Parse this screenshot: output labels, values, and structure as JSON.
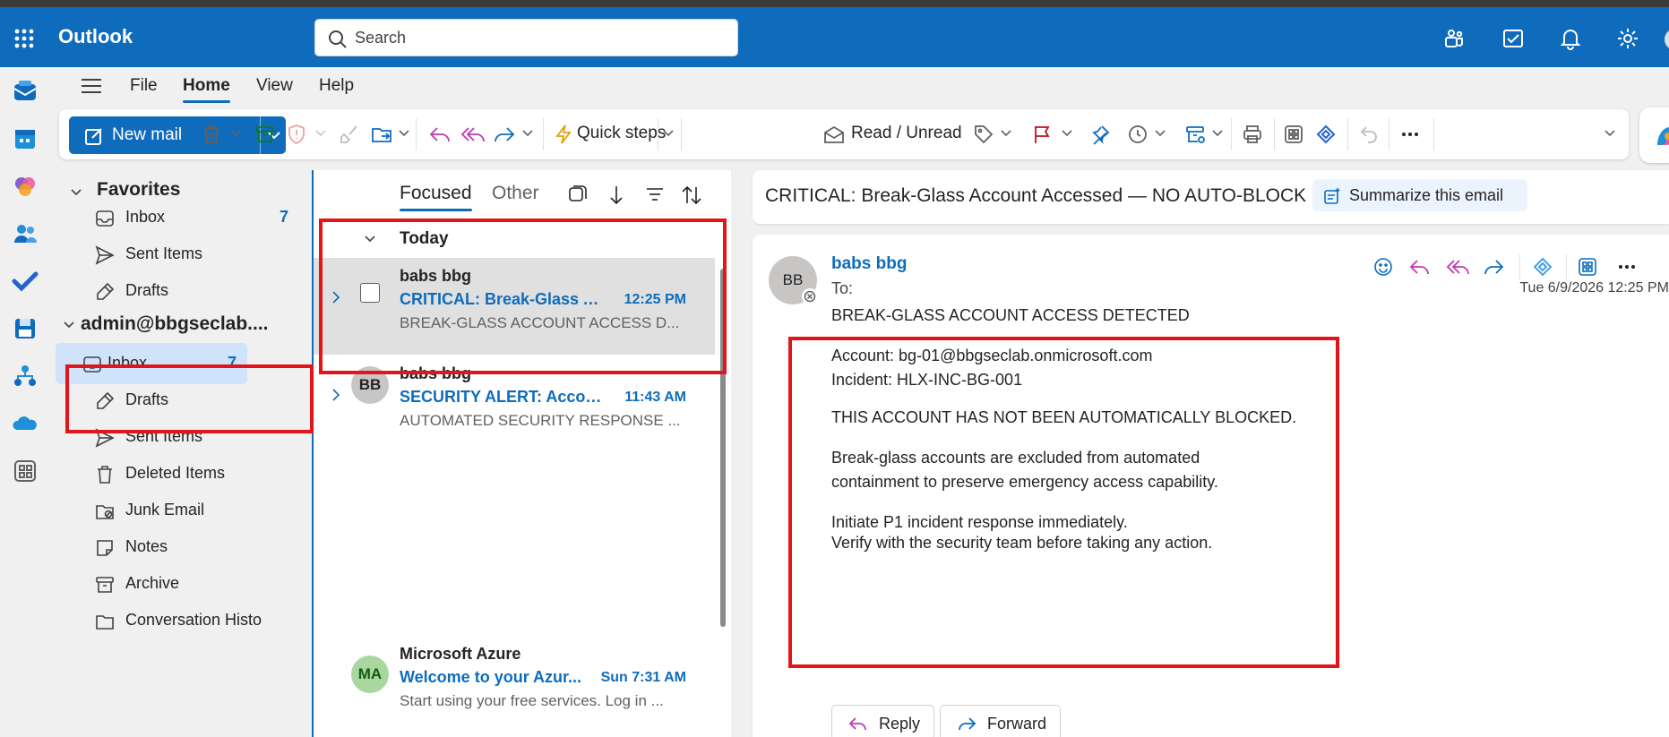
{
  "app": {
    "name": "Outlook"
  },
  "search": {
    "placeholder": "Search"
  },
  "menu": {
    "tabs": [
      {
        "label": "File",
        "active": false
      },
      {
        "label": "Home",
        "active": true
      },
      {
        "label": "View",
        "active": false
      },
      {
        "label": "Help",
        "active": false
      }
    ]
  },
  "ribbon": {
    "new_mail": "New mail",
    "quick_steps": "Quick steps",
    "read_unread": "Read / Unread"
  },
  "folders": {
    "favorites_title": "Favorites",
    "favorites": [
      {
        "label": "Inbox",
        "count": "7",
        "icon": "inbox-icon"
      },
      {
        "label": "Sent Items",
        "count": "",
        "icon": "send-icon"
      },
      {
        "label": "Drafts",
        "count": "",
        "icon": "drafts-icon"
      }
    ],
    "account_title": "admin@bbgseclab....",
    "account_folders": [
      {
        "label": "Inbox",
        "count": "7",
        "icon": "inbox-icon",
        "selected": true
      },
      {
        "label": "Drafts",
        "count": "",
        "icon": "drafts-icon"
      },
      {
        "label": "Sent Items",
        "count": "",
        "icon": "send-icon"
      },
      {
        "label": "Deleted Items",
        "count": "",
        "icon": "trash-icon"
      },
      {
        "label": "Junk Email",
        "count": "",
        "icon": "junk-icon"
      },
      {
        "label": "Notes",
        "count": "",
        "icon": "note-icon"
      },
      {
        "label": "Archive",
        "count": "",
        "icon": "archive-icon"
      },
      {
        "label": "Conversation Histo",
        "count": "",
        "icon": "folder-icon"
      }
    ]
  },
  "message_list": {
    "tabs": {
      "focused": "Focused",
      "other": "Other"
    },
    "group_today": "Today",
    "messages": [
      {
        "sender": "babs bbg",
        "subject": "CRITICAL: Break-Glass Ac...",
        "time": "12:25 PM",
        "preview": "BREAK-GLASS ACCOUNT ACCESS D...",
        "selected": true
      },
      {
        "sender": "babs bbg",
        "initials": "BB",
        "subject": "SECURITY ALERT: Accoun...",
        "time": "11:43 AM",
        "preview": "AUTOMATED SECURITY RESPONSE ..."
      },
      {
        "sender": "Microsoft Azure",
        "initials": "MA",
        "subject": "Welcome to your Azur...",
        "time": "Sun 7:31 AM",
        "preview": "Start using your free services. Log in ..."
      }
    ]
  },
  "reading": {
    "subject": "CRITICAL: Break-Glass Account Accessed — NO AUTO-BLOCK",
    "summarize": "Summarize this email",
    "sender": "babs bbg",
    "initials": "BB",
    "to_label": "To:",
    "date": "Tue 6/9/2026 12:25 PM",
    "body": {
      "line1": "BREAK-GLASS ACCOUNT ACCESS DETECTED",
      "line2": "Account: bg-01@bbgseclab.onmicrosoft.com",
      "line3": "Incident: HLX-INC-BG-001",
      "line4": "THIS ACCOUNT HAS NOT BEEN AUTOMATICALLY BLOCKED.",
      "line5": "Break-glass accounts are excluded from automated",
      "line6": "containment to preserve emergency access capability.",
      "line7": "Initiate P1 incident response immediately.",
      "line8": "Verify with the security team before taking any action."
    },
    "reply": "Reply",
    "forward": "Forward"
  },
  "colors": {
    "brand": "#0f6cbd",
    "annotation_red": "#e3141a",
    "selected_folder": "#cfe4fa"
  }
}
